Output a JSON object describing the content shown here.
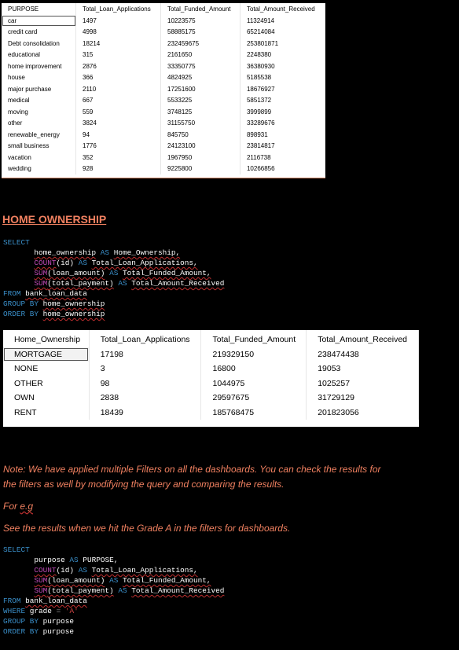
{
  "purpose_table": {
    "columns": [
      "PURPOSE",
      "Total_Loan_Applications",
      "Total_Funded_Amount",
      "Total_Amount_Received"
    ],
    "rows": [
      [
        "car",
        "1497",
        "10223575",
        "11324914"
      ],
      [
        "credit card",
        "4998",
        "58885175",
        "65214084"
      ],
      [
        "Debt consolidation",
        "18214",
        "232459675",
        "253801871"
      ],
      [
        "educational",
        "315",
        "2161650",
        "2248380"
      ],
      [
        "home improvement",
        "2876",
        "33350775",
        "36380930"
      ],
      [
        "house",
        "366",
        "4824925",
        "5185538"
      ],
      [
        "major purchase",
        "2110",
        "17251600",
        "18676927"
      ],
      [
        "medical",
        "667",
        "5533225",
        "5851372"
      ],
      [
        "moving",
        "559",
        "3748125",
        "3999899"
      ],
      [
        "other",
        "3824",
        "31155750",
        "33289676"
      ],
      [
        "renewable_energy",
        "94",
        "845750",
        "898931"
      ],
      [
        "small business",
        "1776",
        "24123100",
        "23814817"
      ],
      [
        "vacation",
        "352",
        "1967950",
        "2116738"
      ],
      [
        "wedding",
        "928",
        "9225800",
        "10266856"
      ]
    ]
  },
  "heading": "HOME OWNERSHIP",
  "home_query": {
    "select": "SELECT",
    "l1_a": "home_ownership",
    "l1_as": "AS",
    "l1_b": "Home_Ownership,",
    "l2_fn": "COUNT",
    "l2_a": "(id)",
    "l2_as": "AS",
    "l2_b": "Total_Loan_Applications,",
    "l3_fn": "SUM",
    "l3_a": "(loan_amount)",
    "l3_as": "AS",
    "l3_b": "Total_Funded_Amount,",
    "l4_fn": "SUM",
    "l4_a": "(total_payment)",
    "l4_as": "AS",
    "l4_b": "Total_Amount_Received",
    "from": "FROM",
    "table": "bank_loan_data",
    "group": "GROUP BY",
    "group_col": "home_ownership",
    "order": "ORDER BY",
    "order_col": "home_ownership"
  },
  "home_table": {
    "columns": [
      "Home_Ownership",
      "Total_Loan_Applications",
      "Total_Funded_Amount",
      "Total_Amount_Received"
    ],
    "rows": [
      [
        "MORTGAGE",
        "17198",
        "219329150",
        "238474438"
      ],
      [
        "NONE",
        "3",
        "16800",
        "19053"
      ],
      [
        "OTHER",
        "98",
        "1044975",
        "1025257"
      ],
      [
        "OWN",
        "2838",
        "29597675",
        "31729129"
      ],
      [
        "RENT",
        "18439",
        "185768475",
        "201823056"
      ]
    ]
  },
  "note": {
    "line1": "Note: We have applied multiple Filters on all the dashboards. You can check the results for",
    "line2": "the filters as well by modifying the query and comparing the results.",
    "for_eg": "For e.g",
    "see": "See the results when we hit the Grade A in the filters for dashboards."
  },
  "grade_query": {
    "select": "SELECT",
    "l1_a": "purpose",
    "l1_as": "AS",
    "l1_b": "PURPOSE,",
    "l2_fn": "COUNT",
    "l2_a": "(id)",
    "l2_as": "AS",
    "l2_b": "Total_Loan_Applications,",
    "l3_fn": "SUM",
    "l3_a": "(loan_amount)",
    "l3_as": "AS",
    "l3_b": "Total_Funded_Amount,",
    "l4_fn": "SUM",
    "l4_a": "(total_payment)",
    "l4_as": "AS",
    "l4_b": "Total_Amount_Received",
    "from": "FROM",
    "table": "bank_loan_data",
    "where": "WHERE",
    "where_col": "grade",
    "eq": "=",
    "where_val": "'A'",
    "group": "GROUP BY",
    "group_col": "purpose",
    "order": "ORDER BY",
    "order_col": "purpose"
  },
  "colors": {
    "heading": "#f08060",
    "keyword": "#3a8ec8",
    "function": "#c04cb8",
    "string": "#d04444"
  }
}
